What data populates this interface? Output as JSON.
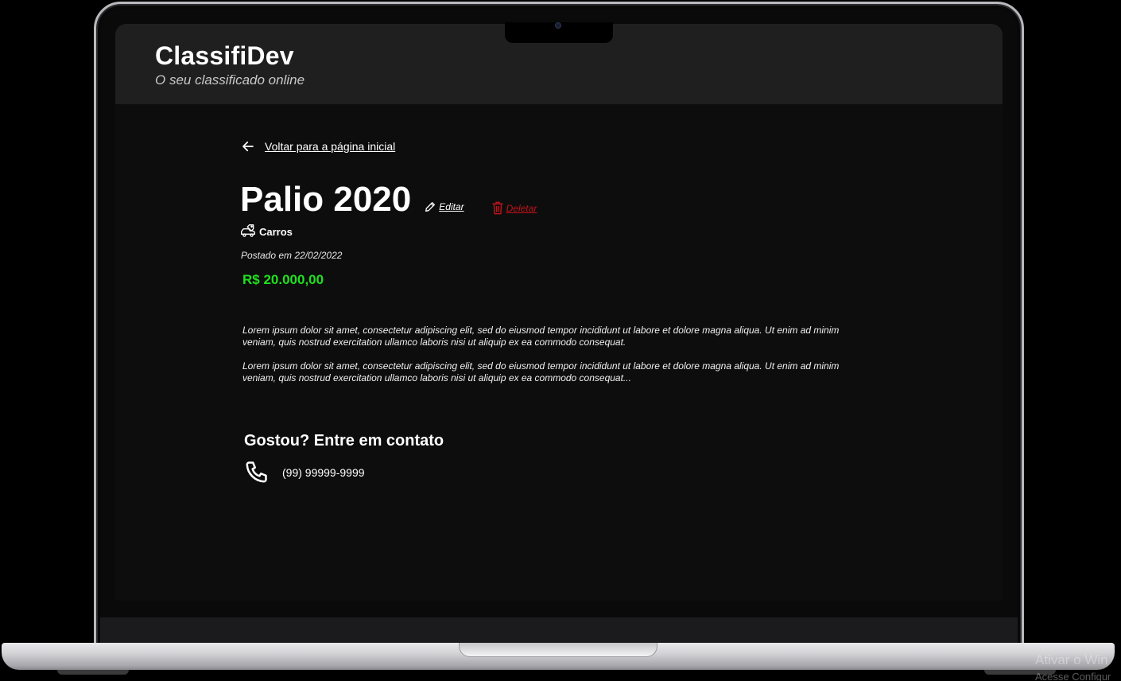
{
  "header": {
    "title": "ClassifiDev",
    "subtitle": "O seu classificado online"
  },
  "nav": {
    "back_label": "Voltar para a página inicial"
  },
  "ad": {
    "title": "Palio 2020",
    "edit_label": "Editar",
    "delete_label": "Deletar",
    "category": "Carros",
    "posted_text": "Postado em 22/02/2022",
    "price": "R$ 20.000,00",
    "description": [
      "Lorem ipsum dolor sit amet, consectetur adipiscing elit, sed do eiusmod tempor incididunt ut labore et dolore magna aliqua. Ut enim ad minim veniam, quis nostrud exercitation ullamco laboris nisi ut aliquip ex ea commodo consequat.",
      "Lorem ipsum dolor sit amet, consectetur adipiscing elit, sed do eiusmod tempor incididunt ut labore et dolore magna aliqua. Ut enim ad minim veniam, quis nostrud exercitation ullamco laboris nisi ut aliquip ex ea commodo consequat..."
    ]
  },
  "contact": {
    "heading": "Gostou? Entre em contato",
    "phone": "(99) 99999-9999"
  },
  "os_watermark": {
    "line1": "Ativar o Win",
    "line2": "Acesse Configur"
  },
  "colors": {
    "price": "#1fe11f",
    "delete": "#c0131b",
    "header_bg": "#1f1f1f",
    "page_bg": "#0d0d0d"
  },
  "icons": {
    "back": "arrow-left-icon",
    "edit": "pencil-icon",
    "delete": "trash-icon",
    "category": "car-tag-icon",
    "phone": "phone-icon"
  }
}
